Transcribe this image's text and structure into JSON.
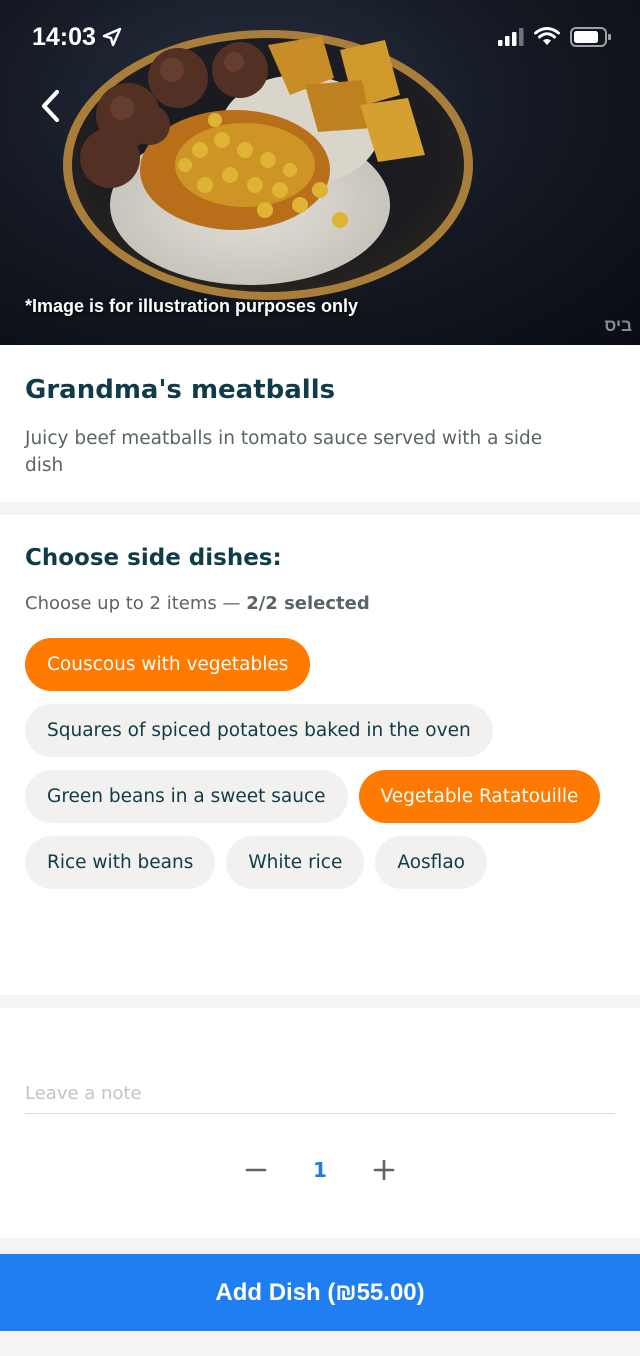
{
  "status_bar": {
    "time": "14:03"
  },
  "hero": {
    "note": "*Image is for illustration purposes only",
    "watermark": "ביס"
  },
  "dish": {
    "name": "Grandma's meatballs",
    "description": "Juicy beef meatballs in tomato sauce served with a side dish"
  },
  "side_dishes": {
    "title": "Choose side dishes:",
    "subtitle_prefix": "Choose up to 2 items — ",
    "subtitle_count": "2/2 selected",
    "options": [
      {
        "label": "Couscous with vegetables",
        "selected": true
      },
      {
        "label": "Squares of spiced potatoes baked in the oven",
        "selected": false
      },
      {
        "label": "Green beans in a sweet sauce",
        "selected": false
      },
      {
        "label": "Vegetable Ratatouille",
        "selected": true
      },
      {
        "label": "Rice with beans",
        "selected": false
      },
      {
        "label": "White rice",
        "selected": false
      },
      {
        "label": "Aosflao",
        "selected": false
      }
    ]
  },
  "note": {
    "placeholder": "Leave a note",
    "value": ""
  },
  "quantity": {
    "minus": "−",
    "value": "1",
    "plus": "+"
  },
  "cta": {
    "label": "Add Dish (₪55.00)"
  },
  "colors": {
    "accent_orange": "#ff7a00",
    "cta_blue": "#1f7ef2",
    "title_teal": "#0f3c48",
    "quantity_blue": "#1e7be0"
  }
}
